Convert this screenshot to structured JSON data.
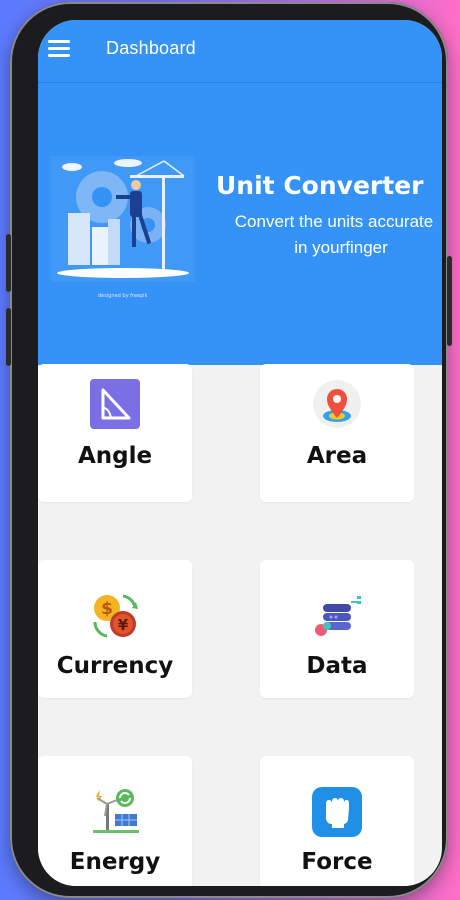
{
  "app_bar": {
    "title": "Dashboard",
    "menu_icon": "hamburger-menu-icon"
  },
  "hero": {
    "title": "Unit Converter",
    "subtitle_line1": "Convert the units accurate",
    "subtitle_line2": "in yourfinger",
    "credit": "designed by freepik",
    "background_color": "#3592f7"
  },
  "categories": [
    {
      "label": "Angle",
      "icon": "angle-triangle-icon"
    },
    {
      "label": "Area",
      "icon": "map-pin-icon"
    },
    {
      "label": "Currency",
      "icon": "currency-exchange-icon"
    },
    {
      "label": "Data",
      "icon": "database-icon"
    },
    {
      "label": "Energy",
      "icon": "wind-solar-energy-icon"
    },
    {
      "label": "Force",
      "icon": "fist-icon"
    }
  ]
}
